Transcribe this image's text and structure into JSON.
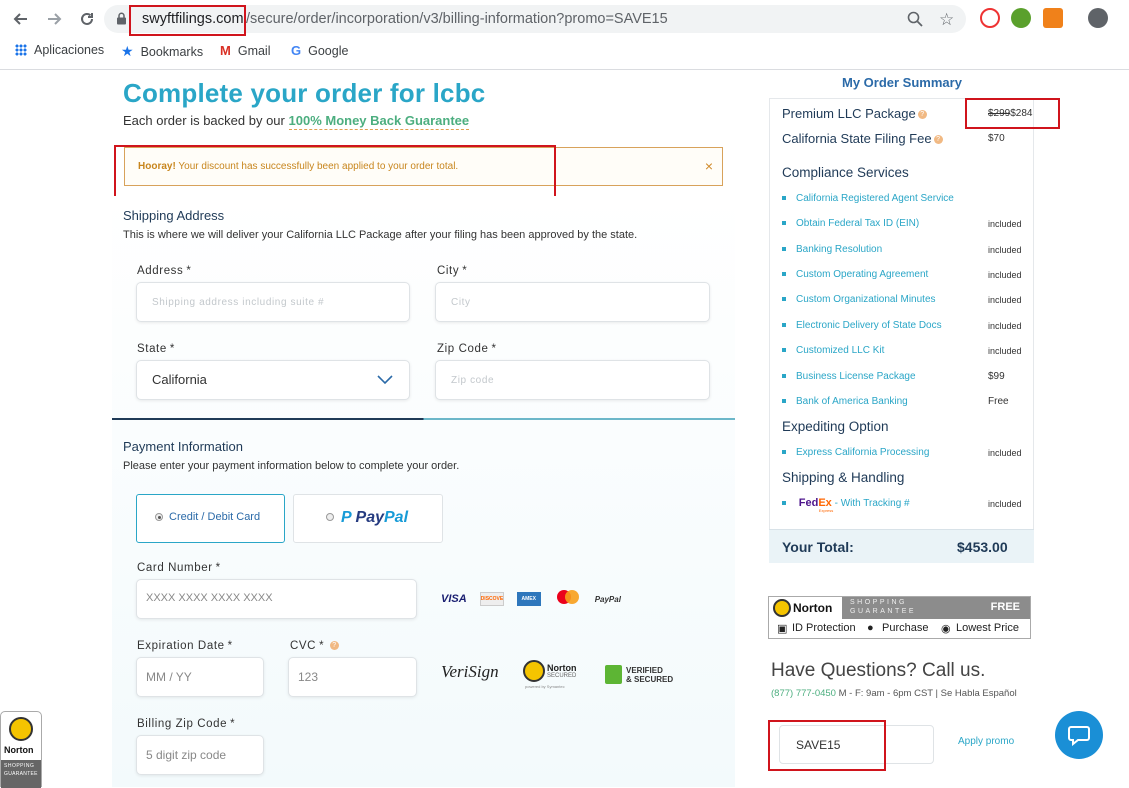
{
  "browser": {
    "url_domain": "swyftfilings.com",
    "url_path": "/secure/order/incorporation/v3/billing-information?promo=SAVE15",
    "bookmarks": [
      {
        "label": "Aplicaciones"
      },
      {
        "label": "Bookmarks"
      },
      {
        "label": "Gmail"
      },
      {
        "label": "Google"
      }
    ]
  },
  "page": {
    "title": "Complete your order for lcbc",
    "backed_prefix": "Each order is backed by our",
    "backed_link": "100% Money Back Guarantee",
    "alert_strong": "Hooray!",
    "alert_text": "Your discount has successfully been applied to your order total.",
    "alert_close": "×"
  },
  "shipping": {
    "heading": "Shipping Address",
    "subtext": "This is where we will deliver your California LLC Package after your filing has been approved by the state.",
    "address_label": "Address",
    "address_placeholder": "Shipping address including suite #",
    "city_label": "City",
    "city_placeholder": "City",
    "state_label": "State",
    "state_value": "California",
    "zip_label": "Zip Code",
    "zip_placeholder": "Zip code",
    "required_mark": "*"
  },
  "payment": {
    "heading": "Payment Information",
    "subtext": "Please enter your payment information below to complete your order.",
    "option_card": "Credit / Debit Card",
    "option_paypal_a": "Pay",
    "option_paypal_b": "Pal",
    "card_label": "Card Number",
    "card_placeholder": "XXXX XXXX XXXX XXXX",
    "exp_label": "Expiration Date",
    "exp_placeholder": "MM / YY",
    "cvc_label": "CVC",
    "cvc_placeholder": "123",
    "zip_label": "Billing Zip Code",
    "zip_placeholder": "5 digit zip code",
    "card_brands": [
      "VISA",
      "DISCOVER",
      "AMEX",
      "mastercard",
      "PayPal"
    ],
    "seal_verisign": "VeriSign",
    "seal_norton": "Norton",
    "seal_norton_sub": "SECURED",
    "seal_norton_by": "powered by Symantec",
    "seal_verified_1": "VERIFIED",
    "seal_verified_2": "& SECURED"
  },
  "summary": {
    "title": "My Order Summary",
    "package_label": "Premium LLC Package",
    "package_old_price": "$299",
    "package_price": "$284",
    "filing_label": "California State Filing Fee",
    "filing_price": "$70",
    "cat_compliance": "Compliance Services",
    "compliance_items": [
      {
        "label": "California Registered Agent Service",
        "value": ""
      },
      {
        "label": "Obtain Federal Tax ID (EIN)",
        "value": "included"
      },
      {
        "label": "Banking Resolution",
        "value": "included"
      },
      {
        "label": "Custom Operating Agreement",
        "value": "included"
      },
      {
        "label": "Custom Organizational Minutes",
        "value": "included"
      },
      {
        "label": "Electronic Delivery of State Docs",
        "value": "included"
      },
      {
        "label": "Customized LLC Kit",
        "value": "included"
      },
      {
        "label": "Business License Package",
        "value": "$99"
      },
      {
        "label": "Bank of America Banking",
        "value": "Free"
      }
    ],
    "cat_expediting": "Expediting Option",
    "expediting_item": "Express California Processing",
    "expediting_value": "included",
    "cat_shipping": "Shipping & Handling",
    "fedex_fed": "Fed",
    "fedex_ex": "Ex",
    "fedex_small": "Express",
    "shipping_item": "- With Tracking #",
    "shipping_value": "included",
    "total_label": "Your Total:",
    "total_value": "$453.00"
  },
  "norton_badge": {
    "brand": "Norton",
    "shopping": "SHOPPING",
    "guarantee": "GUARANTEE",
    "free": "FREE",
    "features": [
      "ID Protection",
      "Purchase",
      "Lowest Price"
    ]
  },
  "contact": {
    "heading": "Have Questions? Call us.",
    "phone": "(877) 777-0450",
    "hours": "M - F: 9am - 6pm CST | Se Habla Español"
  },
  "promo": {
    "value": "SAVE15",
    "apply_label": "Apply promo"
  },
  "side_norton": {
    "brand": "Norton",
    "line1": "SHOPPING",
    "line2": "GUARANTEE"
  },
  "colors": {
    "accent": "#2aa6c7",
    "navy": "#1f3a57",
    "green": "#4cae7f",
    "highlight_box": "#d0141c"
  }
}
